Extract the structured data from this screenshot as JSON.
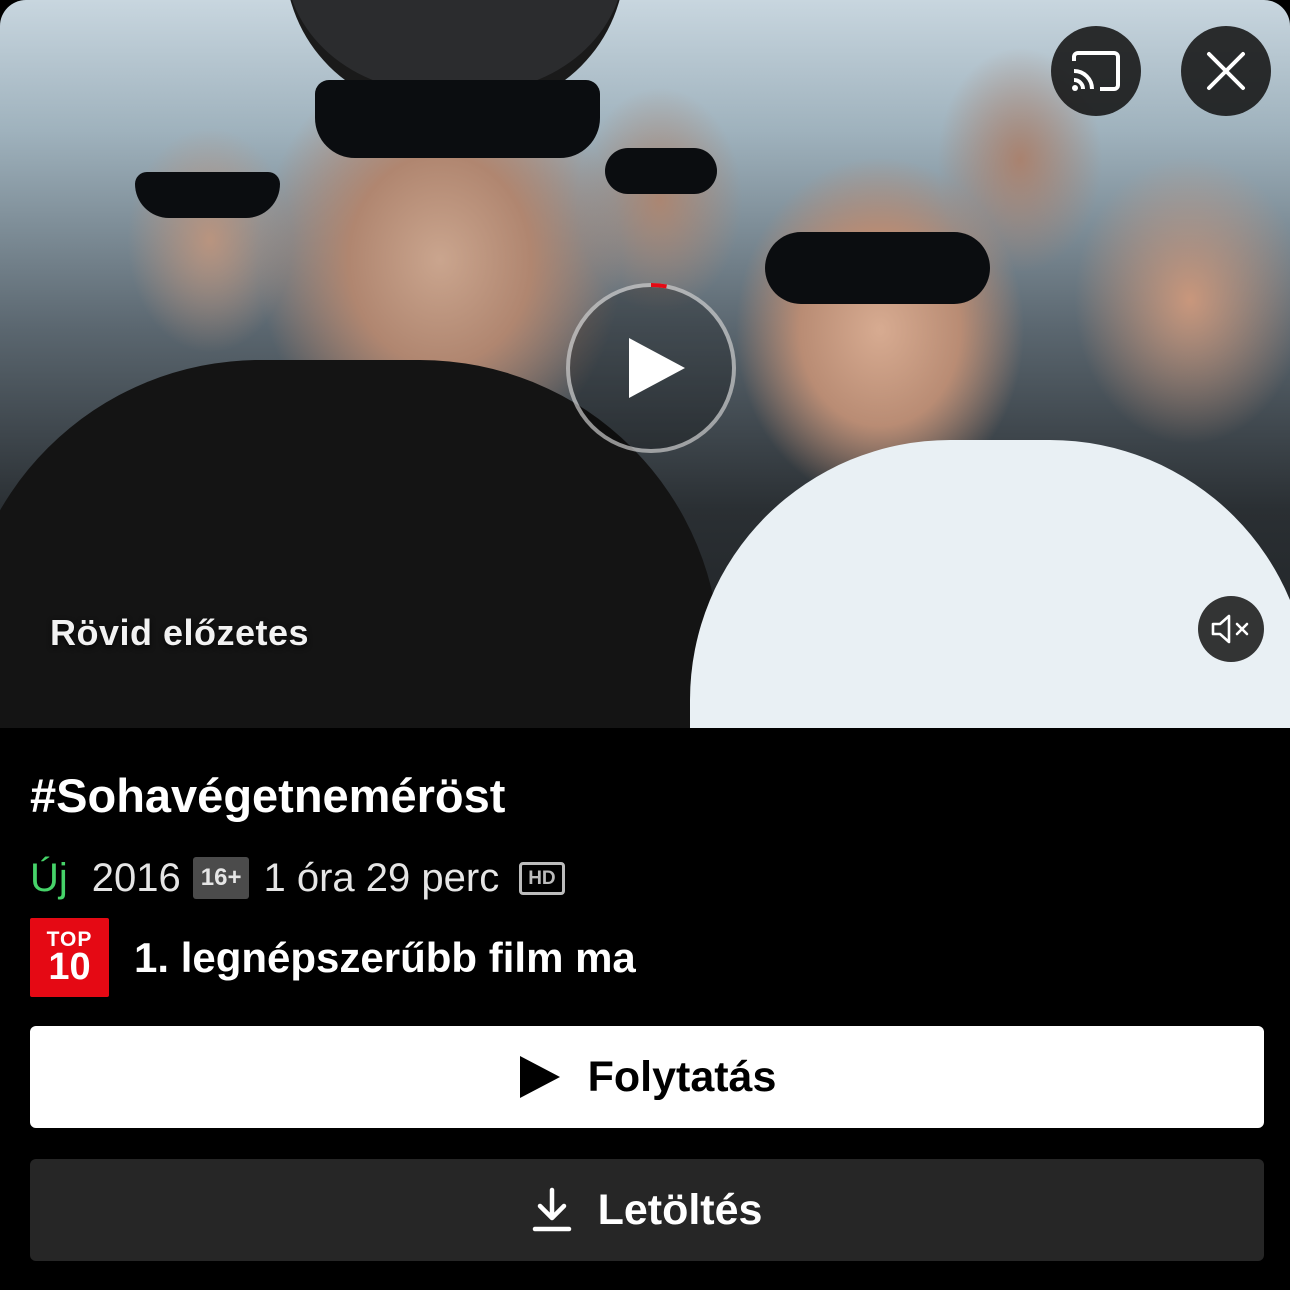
{
  "hero": {
    "preview_label": "Rövid előzetes",
    "cast_icon": "cast-icon",
    "close_icon": "close-icon",
    "play_icon": "play-icon",
    "mute_icon": "volume-muted-icon",
    "play_progress": 0.03
  },
  "details": {
    "title": "#Sohavégetneméröst",
    "new_label": "Új",
    "year": "2016",
    "rating": "16+",
    "duration": "1 óra 29 perc",
    "quality": "HD",
    "top10_badge_top": "TOP",
    "top10_badge_num": "10",
    "top10_text": "1. legnépszerűbb film ma"
  },
  "actions": {
    "play_label": "Folytatás",
    "download_label": "Letöltés"
  },
  "colors": {
    "accent_red": "#e50914",
    "new_green": "#46d369",
    "background": "#000000",
    "download_button": "#262626"
  }
}
